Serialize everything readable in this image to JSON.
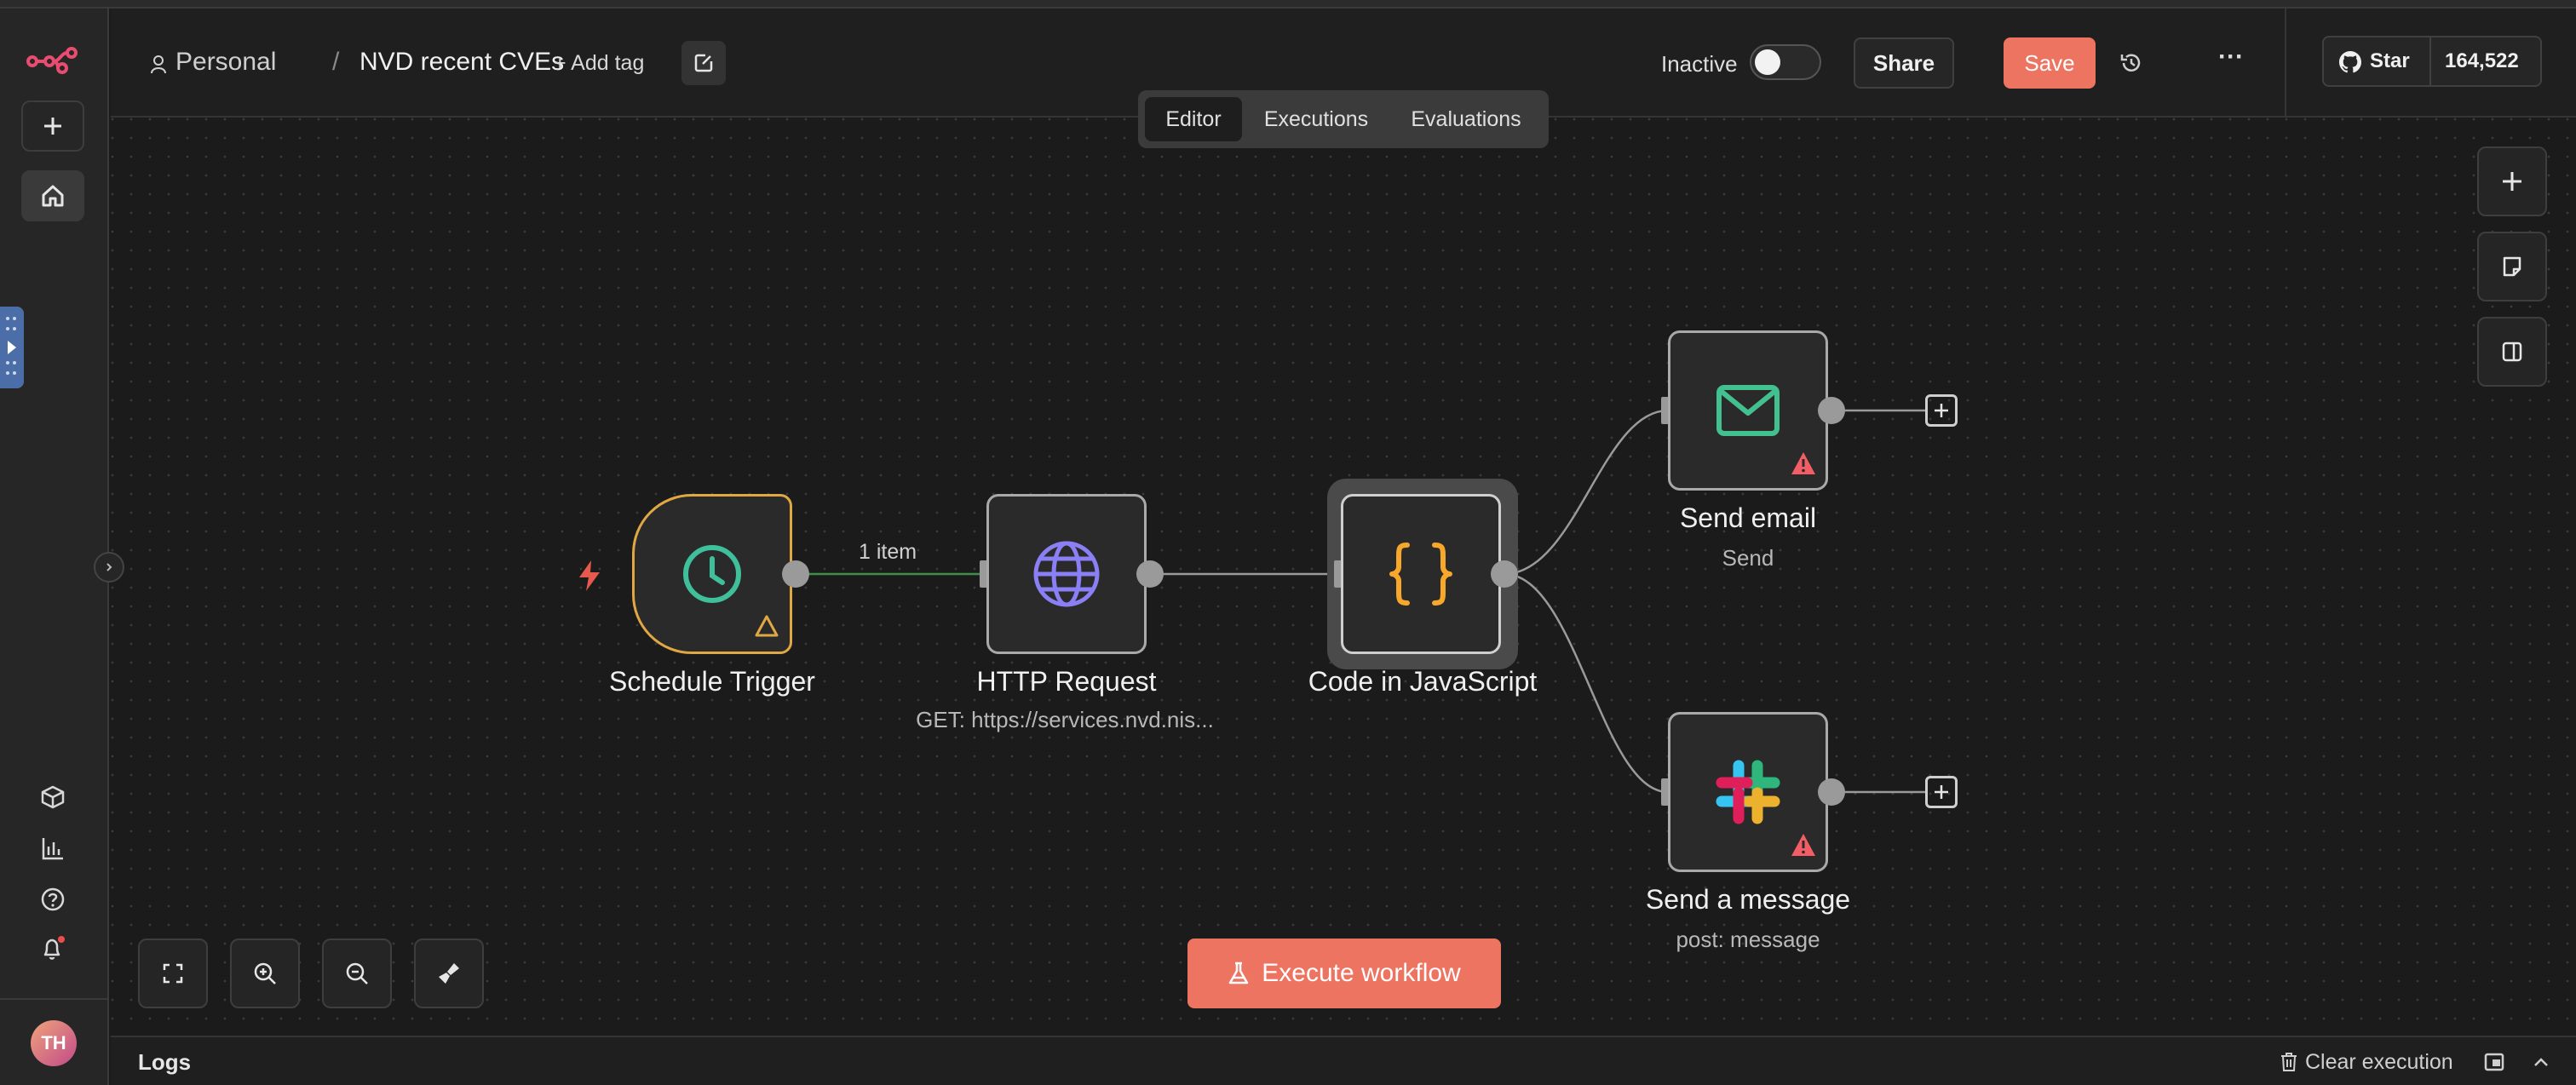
{
  "sidebar": {
    "logo_icon": "n8n-logo-icon",
    "add_icon": "plus-icon",
    "home_icon": "home-icon",
    "templates_icon": "box-icon",
    "insights_icon": "bar-chart-icon",
    "help_icon": "help-circle-icon",
    "notifications_icon": "bell-icon",
    "avatar_initials": "TH"
  },
  "header": {
    "breadcrumb_project": "Personal",
    "breadcrumb_separator": "/",
    "workflow_name": "NVD recent CVEs",
    "add_tag_label": "+ Add tag",
    "status_label": "Inactive",
    "active": false,
    "share_label": "Share",
    "save_label": "Save",
    "more_label": "···",
    "github_star_label": "Star",
    "github_star_count": "164,522"
  },
  "tabs": [
    {
      "label": "Editor",
      "selected": true
    },
    {
      "label": "Executions",
      "selected": false
    },
    {
      "label": "Evaluations",
      "selected": false
    }
  ],
  "canvas": {
    "connection_label": "1 item",
    "nodes": [
      {
        "name": "Schedule Trigger",
        "subtitle": "",
        "icon": "clock-icon",
        "warning": true
      },
      {
        "name": "HTTP Request",
        "subtitle": "GET: https://services.nvd.nis...",
        "icon": "globe-icon",
        "warning": false
      },
      {
        "name": "Code in JavaScript",
        "subtitle": "",
        "icon": "code-braces-icon",
        "warning": false,
        "selected": true
      },
      {
        "name": "Send email",
        "subtitle": "Send",
        "icon": "mail-icon",
        "warning": true
      },
      {
        "name": "Send a message",
        "subtitle": "post: message",
        "icon": "slack-icon",
        "warning": true
      }
    ],
    "execute_label": "Execute workflow"
  },
  "logs": {
    "title": "Logs",
    "clear_label": "Clear execution"
  },
  "colors": {
    "accent": "#ee7462",
    "trigger_border": "#e0a845",
    "success_edge": "#3e8e4a",
    "clock_green": "#3fbf9a",
    "globe_purple": "#8b7ff5",
    "code_orange": "#f7a72a",
    "mail_green": "#43c08f",
    "warning_red": "#f25d66"
  }
}
